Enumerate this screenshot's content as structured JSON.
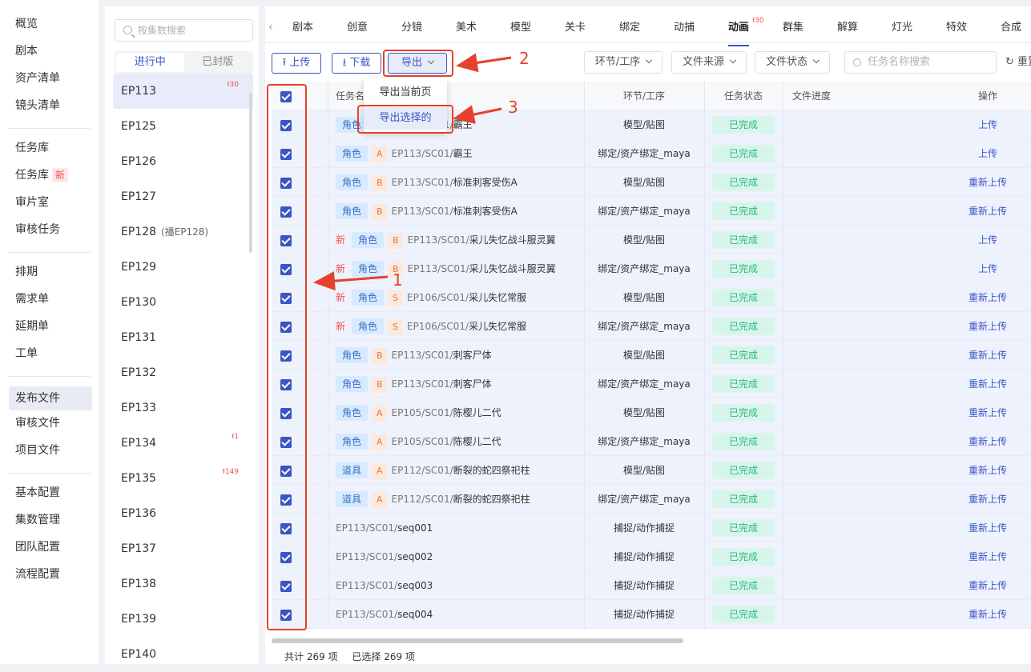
{
  "left_nav": [
    {
      "label": "概览"
    },
    {
      "label": "剧本"
    },
    {
      "label": "资产清单"
    },
    {
      "label": "镜头清单"
    },
    {
      "divider": true
    },
    {
      "label": "任务库"
    },
    {
      "label": "任务库",
      "badge": "新"
    },
    {
      "label": "审片室"
    },
    {
      "label": "审核任务"
    },
    {
      "divider": true
    },
    {
      "label": "排期"
    },
    {
      "label": "需求单"
    },
    {
      "label": "延期单"
    },
    {
      "label": "工单"
    },
    {
      "divider": true
    },
    {
      "label": "发布文件",
      "active": true
    },
    {
      "label": "审核文件"
    },
    {
      "label": "项目文件"
    },
    {
      "divider": true
    },
    {
      "label": "基本配置"
    },
    {
      "label": "集数管理"
    },
    {
      "label": "团队配置"
    },
    {
      "label": "流程配置"
    }
  ],
  "episode_panel": {
    "search_placeholder": "按集数搜索",
    "tabs": [
      "进行中",
      "已封版"
    ],
    "episodes": [
      {
        "label": "EP113",
        "count": "30",
        "active": true
      },
      {
        "label": "EP125"
      },
      {
        "label": "EP126"
      },
      {
        "label": "EP127"
      },
      {
        "label": "EP128",
        "note": "(播EP128)"
      },
      {
        "label": "EP129"
      },
      {
        "label": "EP130"
      },
      {
        "label": "EP131"
      },
      {
        "label": "EP132"
      },
      {
        "label": "EP133"
      },
      {
        "label": "EP134",
        "count": "1"
      },
      {
        "label": "EP135",
        "count": "149"
      },
      {
        "label": "EP136"
      },
      {
        "label": "EP137"
      },
      {
        "label": "EP138"
      },
      {
        "label": "EP139"
      },
      {
        "label": "EP140"
      }
    ]
  },
  "stage_tabs": [
    {
      "label": "剧本"
    },
    {
      "label": "创意"
    },
    {
      "label": "分镜"
    },
    {
      "label": "美术"
    },
    {
      "label": "模型"
    },
    {
      "label": "关卡"
    },
    {
      "label": "绑定"
    },
    {
      "label": "动捕"
    },
    {
      "label": "动画",
      "count": "30",
      "active": true
    },
    {
      "label": "群集"
    },
    {
      "label": "解算"
    },
    {
      "label": "灯光"
    },
    {
      "label": "特效"
    },
    {
      "label": "合成"
    }
  ],
  "toolbar": {
    "upload": "上传",
    "download": "下载",
    "export": "导出",
    "filters": [
      "环节/工序",
      "文件来源",
      "文件状态"
    ],
    "search_placeholder": "任务名称搜索",
    "reset": "重置"
  },
  "export_menu": [
    "导出当前页",
    "导出选择的"
  ],
  "table": {
    "columns": [
      "任务名",
      "环节/工序",
      "任务状态",
      "文件进度",
      "操作"
    ],
    "rows": [
      {
        "new": false,
        "cat": "角色",
        "grade": "A",
        "prefix": "EP113/SC01/",
        "name": "霸王",
        "step": "模型/贴图",
        "status": "已完成",
        "op": "上传"
      },
      {
        "new": false,
        "cat": "角色",
        "grade": "A",
        "prefix": "EP113/SC01/",
        "name": "霸王",
        "step": "绑定/资产绑定_maya",
        "status": "已完成",
        "op": "上传"
      },
      {
        "new": false,
        "cat": "角色",
        "grade": "B",
        "prefix": "EP113/SC01/",
        "name": "标准刺客受伤A",
        "step": "模型/贴图",
        "status": "已完成",
        "op": "重新上传"
      },
      {
        "new": false,
        "cat": "角色",
        "grade": "B",
        "prefix": "EP113/SC01/",
        "name": "标准刺客受伤A",
        "step": "绑定/资产绑定_maya",
        "status": "已完成",
        "op": "重新上传"
      },
      {
        "new": true,
        "cat": "角色",
        "grade": "B",
        "prefix": "EP113/SC01/",
        "name": "采儿失忆战斗服灵翼",
        "step": "模型/贴图",
        "status": "已完成",
        "op": "上传"
      },
      {
        "new": true,
        "cat": "角色",
        "grade": "B",
        "prefix": "EP113/SC01/",
        "name": "采儿失忆战斗服灵翼",
        "step": "绑定/资产绑定_maya",
        "status": "已完成",
        "op": "上传"
      },
      {
        "new": true,
        "cat": "角色",
        "grade": "S",
        "prefix": "EP106/SC01/",
        "name": "采儿失忆常服",
        "step": "模型/贴图",
        "status": "已完成",
        "op": "重新上传"
      },
      {
        "new": true,
        "cat": "角色",
        "grade": "S",
        "prefix": "EP106/SC01/",
        "name": "采儿失忆常服",
        "step": "绑定/资产绑定_maya",
        "status": "已完成",
        "op": "重新上传"
      },
      {
        "new": false,
        "cat": "角色",
        "grade": "B",
        "prefix": "EP113/SC01/",
        "name": "刺客尸体",
        "step": "模型/贴图",
        "status": "已完成",
        "op": "重新上传"
      },
      {
        "new": false,
        "cat": "角色",
        "grade": "B",
        "prefix": "EP113/SC01/",
        "name": "刺客尸体",
        "step": "绑定/资产绑定_maya",
        "status": "已完成",
        "op": "重新上传"
      },
      {
        "new": false,
        "cat": "角色",
        "grade": "A",
        "prefix": "EP105/SC01/",
        "name": "陈樱儿二代",
        "step": "模型/贴图",
        "status": "已完成",
        "op": "重新上传"
      },
      {
        "new": false,
        "cat": "角色",
        "grade": "A",
        "prefix": "EP105/SC01/",
        "name": "陈樱儿二代",
        "step": "绑定/资产绑定_maya",
        "status": "已完成",
        "op": "重新上传"
      },
      {
        "new": false,
        "cat": "道具",
        "grade": "A",
        "prefix": "EP112/SC01/",
        "name": "断裂的蛇四祭祀柱",
        "step": "模型/贴图",
        "status": "已完成",
        "op": "重新上传"
      },
      {
        "new": false,
        "cat": "道具",
        "grade": "A",
        "prefix": "EP112/SC01/",
        "name": "断裂的蛇四祭祀柱",
        "step": "绑定/资产绑定_maya",
        "status": "已完成",
        "op": "重新上传"
      },
      {
        "new": false,
        "cat": "",
        "grade": "",
        "prefix": "EP113/SC01/",
        "name": "seq001",
        "step": "捕捉/动作捕捉",
        "status": "已完成",
        "op": "重新上传"
      },
      {
        "new": false,
        "cat": "",
        "grade": "",
        "prefix": "EP113/SC01/",
        "name": "seq002",
        "step": "捕捉/动作捕捉",
        "status": "已完成",
        "op": "重新上传"
      },
      {
        "new": false,
        "cat": "",
        "grade": "",
        "prefix": "EP113/SC01/",
        "name": "seq003",
        "step": "捕捉/动作捕捉",
        "status": "已完成",
        "op": "重新上传"
      },
      {
        "new": false,
        "cat": "",
        "grade": "",
        "prefix": "EP113/SC01/",
        "name": "seq004",
        "step": "捕捉/动作捕捉",
        "status": "已完成",
        "op": "重新上传"
      }
    ]
  },
  "footer": {
    "total": "共计 269 项",
    "selected": "已选择 269 项"
  },
  "annotations": [
    "1",
    "2",
    "3"
  ],
  "colors": {
    "accent": "#3a55c6",
    "annotation": "#e5412d",
    "success": "#2eb67d",
    "new": "#f5504f"
  }
}
